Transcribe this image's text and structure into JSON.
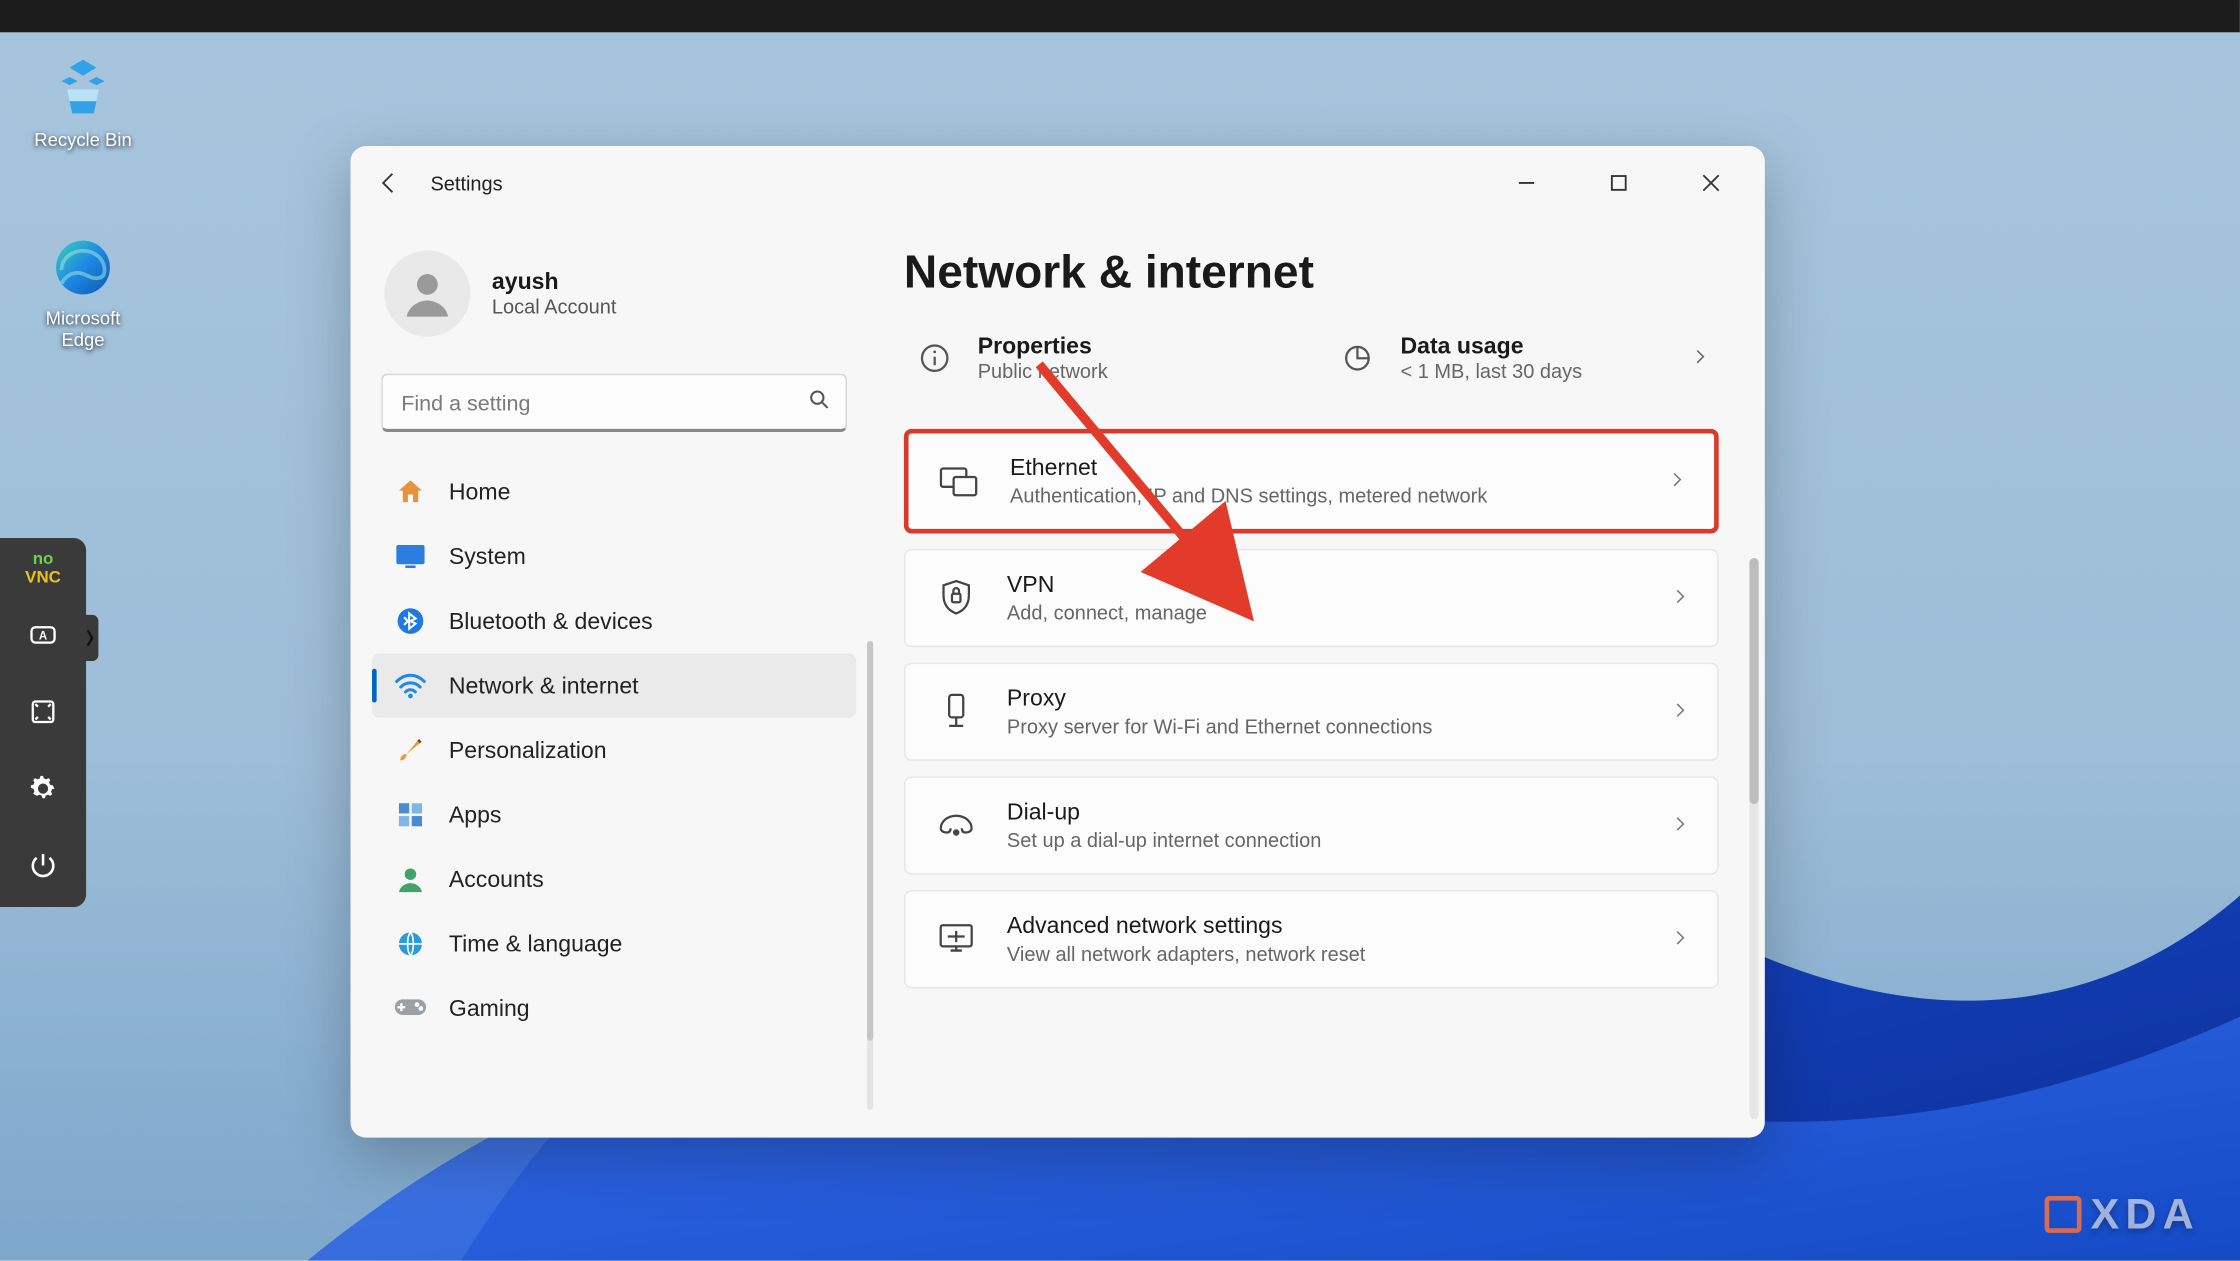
{
  "desktop": {
    "recycle_bin_label": "Recycle Bin",
    "edge_label": "Microsoft Edge"
  },
  "vnc": {
    "brand_top": "no",
    "brand_bottom": "VNC"
  },
  "window": {
    "title": "Settings",
    "account": {
      "name": "ayush",
      "type": "Local Account"
    },
    "search_placeholder": "Find a setting",
    "nav": [
      {
        "key": "home",
        "label": "Home",
        "icon": "home",
        "selected": false
      },
      {
        "key": "system",
        "label": "System",
        "icon": "system",
        "selected": false
      },
      {
        "key": "bluetooth",
        "label": "Bluetooth & devices",
        "icon": "bluetooth",
        "selected": false
      },
      {
        "key": "network",
        "label": "Network & internet",
        "icon": "wifi",
        "selected": true
      },
      {
        "key": "personalization",
        "label": "Personalization",
        "icon": "brush",
        "selected": false
      },
      {
        "key": "apps",
        "label": "Apps",
        "icon": "apps",
        "selected": false
      },
      {
        "key": "accounts",
        "label": "Accounts",
        "icon": "accounts",
        "selected": false
      },
      {
        "key": "time",
        "label": "Time & language",
        "icon": "globe",
        "selected": false
      },
      {
        "key": "gaming",
        "label": "Gaming",
        "icon": "gaming",
        "selected": false
      }
    ],
    "main": {
      "title": "Network & internet",
      "info": {
        "properties": {
          "title": "Properties",
          "sub": "Public network"
        },
        "data_usage": {
          "title": "Data usage",
          "sub": "< 1 MB, last 30 days"
        }
      },
      "cards": [
        {
          "key": "ethernet",
          "title": "Ethernet",
          "sub": "Authentication, IP and DNS settings, metered network",
          "highlighted": true
        },
        {
          "key": "vpn",
          "title": "VPN",
          "sub": "Add, connect, manage",
          "highlighted": false
        },
        {
          "key": "proxy",
          "title": "Proxy",
          "sub": "Proxy server for Wi-Fi and Ethernet connections",
          "highlighted": false
        },
        {
          "key": "dialup",
          "title": "Dial-up",
          "sub": "Set up a dial-up internet connection",
          "highlighted": false
        },
        {
          "key": "advanced",
          "title": "Advanced network settings",
          "sub": "View all network adapters, network reset",
          "highlighted": false
        }
      ]
    }
  },
  "watermark": "XDA"
}
